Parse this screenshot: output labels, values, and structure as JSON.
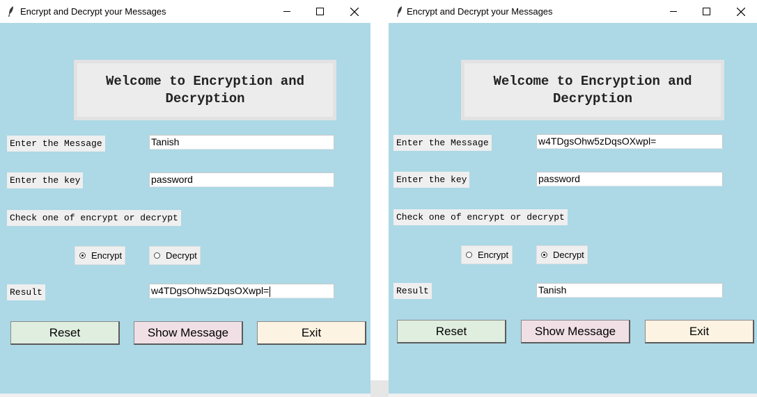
{
  "window_title": "Encrypt and Decrypt your Messages",
  "header": "Welcome to Encryption and Decryption",
  "labels": {
    "message": "Enter the Message",
    "key": "Enter the key",
    "mode": "Check one of encrypt or decrypt",
    "result": "Result"
  },
  "options": {
    "encrypt": "Encrypt",
    "decrypt": "Decrypt"
  },
  "buttons": {
    "reset": "Reset",
    "show": "Show Message",
    "exit": "Exit"
  },
  "windows": [
    {
      "message": "Tanish",
      "key": "password",
      "selected_mode": "Encrypt",
      "result": "w4TDgsOhw5zDqsOXwpl="
    },
    {
      "message": "w4TDgsOhw5zDqsOXwpl=",
      "key": "password",
      "selected_mode": "Decrypt",
      "result": "Tanish"
    }
  ],
  "icons": {
    "app": "feather-icon",
    "minimize": "minimize-icon",
    "maximize": "maximize-icon",
    "close": "close-icon"
  },
  "colors": {
    "window_bg": "#add8e6",
    "reset_bg": "#dfeedf",
    "show_bg": "#f0e0e6",
    "exit_bg": "#fdf3e2"
  }
}
